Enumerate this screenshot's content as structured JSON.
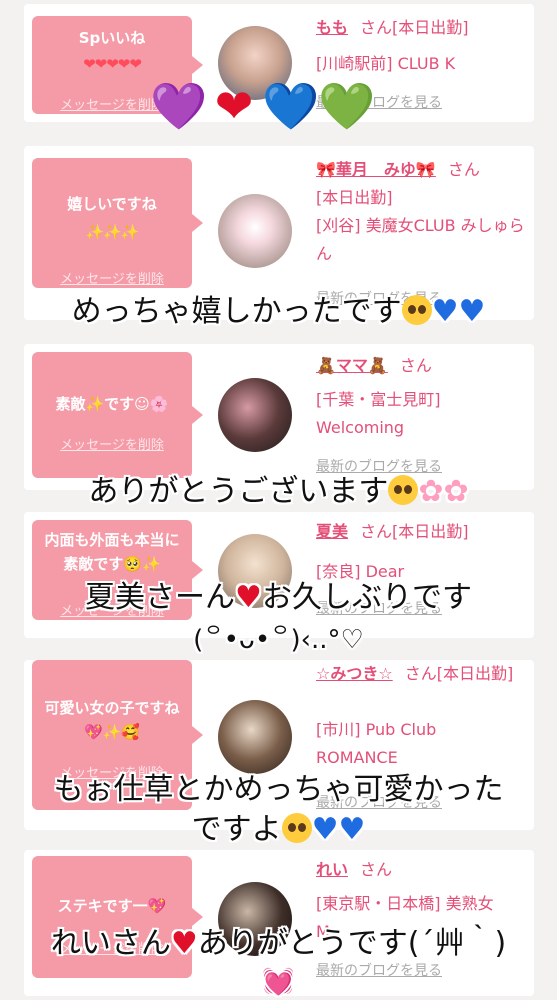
{
  "cards": [
    {
      "bubble_text": "Spいいね",
      "bubble_sub": "❤❤❤❤❤",
      "delete_label": "メッセージを削除",
      "name": "もも",
      "san": "さん[本日出勤]",
      "shop": "[川崎駅前] CLUB K",
      "blog_label": "最新のブログを見る"
    },
    {
      "bubble_text": "嬉しいですね",
      "bubble_sub": "✨✨✨",
      "delete_label": "メッセージを削除",
      "name": "🎀華月　みゆ🎀",
      "san": "さん",
      "status": "[本日出勤]",
      "shop": "[刈谷] 美魔女CLUB みしゅらん",
      "blog_label": "最新のブログを見る"
    },
    {
      "bubble_text": "素敵✨です☺🌸",
      "delete_label": "メッセージを削除",
      "name": "🧸ママ🧸",
      "san": "さん",
      "shop": "[千葉・富士見町] Welcoming",
      "blog_label": "最新のブログを見る"
    },
    {
      "bubble_text": "内面も外面も本当に素敵です🥺✨",
      "delete_label": "メッセージを削除",
      "name": "夏美",
      "san": "さん[本日出勤]",
      "shop": "[奈良] Dear",
      "blog_label": "最新のブログを見る"
    },
    {
      "bubble_text": "可愛い女の子ですね💖✨🥰",
      "delete_label": "メッセージを削除",
      "name": "☆みつき☆",
      "san": "さん[本日出勤]",
      "shop": "[市川] Pub Club ROMANCE",
      "blog_label": "最新のブログを見る"
    },
    {
      "bubble_text": "ステキです一💖",
      "delete_label": "メッセージを削除",
      "name": "れい",
      "san": "さん",
      "shop": "[東京駅・日本橋] 美熟女 M",
      "blog_label": "最新のブログを見る"
    }
  ],
  "overlays": {
    "hearts": [
      "💜",
      "❤",
      "💙",
      "💚"
    ],
    "line1": "めっちゃ嬉しかったです",
    "line2": "ありがとうございます",
    "line3a": "夏美さーん",
    "line3b": "お久しぶりです",
    "line3c": "(꒪•ᴗ•꒪)‹..°♡",
    "line4a": "もぉ仕草とかめっちゃ可愛かった",
    "line4b": "ですよ",
    "line5a": "れいさん",
    "line5b": "ありがとうです(´艸｀)",
    "line5c": "💓"
  },
  "colors": {
    "bubble": "#f59aa7",
    "accent": "#e34f78",
    "background": "#f4f1f1"
  }
}
